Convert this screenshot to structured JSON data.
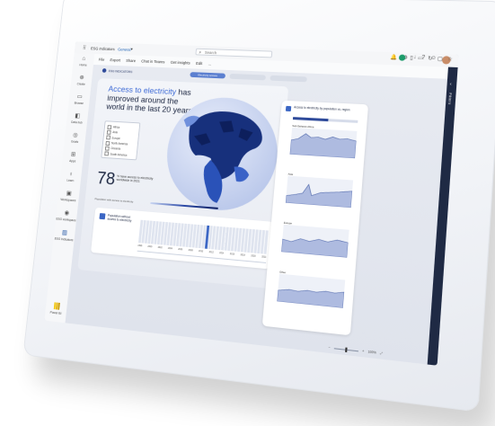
{
  "title_bar": {
    "app_name": "ESG Indicators",
    "workspace": "General",
    "search_placeholder": "Search"
  },
  "ribbon": {
    "file": "File",
    "export": "Export",
    "share": "Share",
    "chat_in_teams": "Chat in Teams",
    "get_insights": "Get insights",
    "edit": "Edit",
    "more": "..."
  },
  "left_nav": [
    {
      "icon": "home-icon",
      "label": "Home"
    },
    {
      "icon": "plus-icon",
      "label": "Create"
    },
    {
      "icon": "folder-icon",
      "label": "Browse"
    },
    {
      "icon": "hub-icon",
      "label": "Data hub"
    },
    {
      "icon": "goals-icon",
      "label": "Goals"
    },
    {
      "icon": "apps-icon",
      "label": "Apps"
    },
    {
      "icon": "learn-icon",
      "label": "Learn"
    },
    {
      "icon": "workspaces-icon",
      "label": "Workspaces"
    },
    {
      "icon": "workspace-icon",
      "label": "ESG workspace"
    },
    {
      "icon": "report-icon",
      "label": "ESG Indicators"
    }
  ],
  "nav_bottom_label": "Power BI",
  "page_tabs": [
    {
      "label": "Electricity access",
      "active": true
    },
    {
      "label": "",
      "active": false
    },
    {
      "label": "",
      "active": false
    }
  ],
  "report": {
    "name": "ESG INDICATORS",
    "headline_prefix": "Access to electricity",
    "headline_suffix": " has improved around the world in the last 20 years",
    "region_options": [
      "Africa",
      "Asia",
      "Europe",
      "North America",
      "Oceania",
      "South America"
    ],
    "big_number": "78",
    "big_number_label": "% have access to electricity worldwide in 2021",
    "legend_text": "Population with access to electricity",
    "timeline_title": "Population without access to electricity",
    "years": [
      "1998",
      "2000",
      "2002",
      "2004",
      "2006",
      "2008",
      "2010",
      "2012",
      "2014",
      "2016",
      "2018",
      "2020",
      "2021"
    ]
  },
  "side_panel": {
    "title": "Access to electricity by population vs. region",
    "charts": [
      {
        "label": "Sub-Saharan Africa"
      },
      {
        "label": "Asia"
      },
      {
        "label": "Europe"
      },
      {
        "label": "Other"
      }
    ]
  },
  "filters_label": "Filters",
  "status": {
    "zoom": "100%"
  },
  "colors": {
    "accent": "#3d6ad6",
    "dark_blue": "#1b2540",
    "filters_bg": "#1f2a44"
  }
}
